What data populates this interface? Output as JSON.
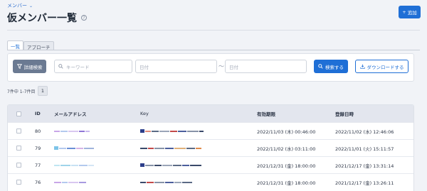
{
  "breadcrumb": {
    "label": "メンバー"
  },
  "header": {
    "title": "仮メンバー一覧",
    "add_label": "追加"
  },
  "tabs": [
    {
      "label": "一覧",
      "active": true
    },
    {
      "label": "アプローチ",
      "active": false
    }
  ],
  "search": {
    "detail_label": "詳細検索",
    "keyword_placeholder": "キーワード",
    "date_from_placeholder": "日付",
    "date_to_placeholder": "日付",
    "range_separator": "〜",
    "search_label": "検索する",
    "download_label": "ダウンロードする"
  },
  "pagination": {
    "summary": "7件中 1-7件目",
    "current_page": "1"
  },
  "table": {
    "columns": [
      "ID",
      "メールアドレス",
      "Key",
      "有効期限",
      "登録日時"
    ],
    "rows": [
      {
        "id": "80",
        "expires": "2022/11/03 (木) 00:46:00",
        "registered": "2022/11/02 (水) 12:46:06"
      },
      {
        "id": "79",
        "expires": "2022/11/02 (水) 03:11:00",
        "registered": "2022/11/01 (火) 15:11:57"
      },
      {
        "id": "77",
        "expires": "2021/12/31 (金) 18:00:00",
        "registered": "2021/12/17 (金) 13:31:14"
      },
      {
        "id": "76",
        "expires": "2021/12/31 (金) 18:00:00",
        "registered": "2021/12/17 (金) 13:26:11"
      }
    ]
  },
  "colors": {
    "primary": "#1f6fd6",
    "header_bg": "#e3e6ee",
    "detail_btn": "#6b7a92"
  }
}
